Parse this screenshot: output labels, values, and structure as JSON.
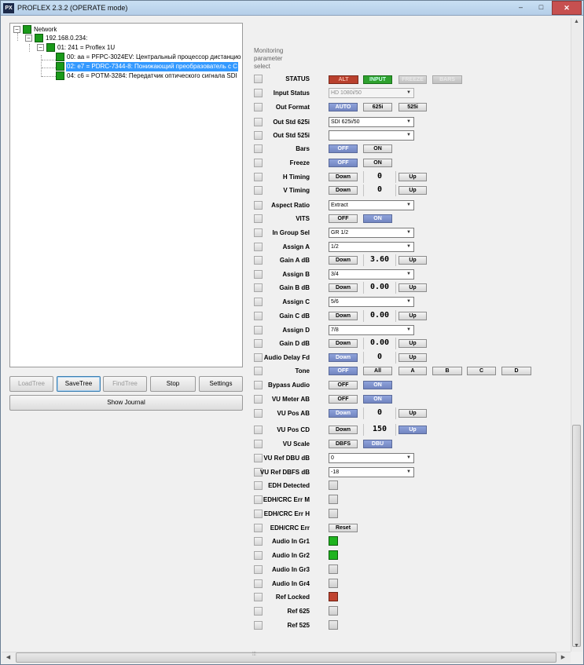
{
  "window": {
    "app_icon": "PX",
    "title": "PROFLEX 2.3.2 (OPERATE mode)",
    "minimize_glyph": "–",
    "maximize_glyph": "□",
    "close_glyph": "✕"
  },
  "tree": {
    "root": "Network",
    "ip": "192.168.0.234:",
    "chassis": "01: 241 = Proflex 1U",
    "cards": [
      "00: aa = PFPC-3024EV: Центральный процессор дистанцио",
      "02: e7 = PDRC-7344-8: Понижающий преобразователь с С",
      "04: c6 = POTM-3284: Передатчик оптического сигнала SDI"
    ],
    "expand_glyph": "−"
  },
  "buttons": {
    "load_tree": "LoadTree",
    "save_tree": "SaveTree",
    "find_tree": "FindTree",
    "stop": "Stop",
    "settings": "Settings",
    "show_journal": "Show Journal"
  },
  "monitor_header": "Monitoring parameter select",
  "params": {
    "status": {
      "label": "STATUS",
      "flags": [
        "ALT",
        "INPUT",
        "FREEZE",
        "BARS"
      ]
    },
    "input_status": {
      "label": "Input Status",
      "value": "HD 1080i/50"
    },
    "out_format": {
      "label": "Out Format",
      "options": [
        "AUTO",
        "625i",
        "525i"
      ]
    },
    "out_std_625i": {
      "label": "Out Std 625i",
      "value": "SDI 625i/50"
    },
    "out_std_525i": {
      "label": "Out Std 525i",
      "value": ""
    },
    "bars": {
      "label": "Bars",
      "off": "OFF",
      "on": "ON"
    },
    "freeze": {
      "label": "Freeze",
      "off": "OFF",
      "on": "ON"
    },
    "h_timing": {
      "label": "H Timing",
      "down": "Down",
      "value": "0",
      "up": "Up"
    },
    "v_timing": {
      "label": "V Timing",
      "down": "Down",
      "value": "0",
      "up": "Up"
    },
    "aspect_ratio": {
      "label": "Aspect Ratio",
      "value": "Extract"
    },
    "vits": {
      "label": "VITS",
      "off": "OFF",
      "on": "ON"
    },
    "in_group_sel": {
      "label": "In Group Sel",
      "value": "GR 1/2"
    },
    "assign_a": {
      "label": "Assign A",
      "value": "1/2"
    },
    "gain_a": {
      "label": "Gain A dB",
      "down": "Down",
      "value": "3.60",
      "up": "Up"
    },
    "assign_b": {
      "label": "Assign B",
      "value": "3/4"
    },
    "gain_b": {
      "label": "Gain B dB",
      "down": "Down",
      "value": "0.00",
      "up": "Up"
    },
    "assign_c": {
      "label": "Assign C",
      "value": "5/6"
    },
    "gain_c": {
      "label": "Gain C dB",
      "down": "Down",
      "value": "0.00",
      "up": "Up"
    },
    "assign_d": {
      "label": "Assign D",
      "value": "7/8"
    },
    "gain_d": {
      "label": "Gain D dB",
      "down": "Down",
      "value": "0.00",
      "up": "Up"
    },
    "audio_delay": {
      "label": "Audio Delay Fd",
      "down": "Down",
      "value": "0",
      "up": "Up"
    },
    "tone": {
      "label": "Tone",
      "options": [
        "OFF",
        "All",
        "A",
        "B",
        "C",
        "D"
      ]
    },
    "bypass_audio": {
      "label": "Bypass Audio",
      "off": "OFF",
      "on": "ON"
    },
    "vu_meter_ab": {
      "label": "VU Meter AB",
      "off": "OFF",
      "on": "ON"
    },
    "vu_pos_ab": {
      "label": "VU Pos AB",
      "down": "Down",
      "value": "0",
      "up": "Up"
    },
    "vu_pos_cd": {
      "label": "VU Pos CD",
      "down": "Down",
      "value": "150",
      "up": "Up"
    },
    "vu_scale": {
      "label": "VU Scale",
      "options": [
        "DBFS",
        "DBU"
      ]
    },
    "vu_ref_dbu": {
      "label": "VU Ref DBU dB",
      "value": "0"
    },
    "vu_ref_dbfs": {
      "label": "VU Ref DBFS dB",
      "value": "-18"
    },
    "edh_detected": {
      "label": "EDH Detected"
    },
    "edh_crc_err_m": {
      "label": "EDH/CRC Err M"
    },
    "edh_crc_err_h": {
      "label": "EDH/CRC Err H"
    },
    "edh_crc_err": {
      "label": "EDH/CRC Err",
      "reset": "Reset"
    },
    "audio_in_gr1": {
      "label": "Audio In Gr1"
    },
    "audio_in_gr2": {
      "label": "Audio In Gr2"
    },
    "audio_in_gr3": {
      "label": "Audio In Gr3"
    },
    "audio_in_gr4": {
      "label": "Audio In Gr4"
    },
    "ref_locked": {
      "label": "Ref Locked"
    },
    "ref_625": {
      "label": "Ref 625"
    },
    "ref_525": {
      "label": "Ref 525"
    }
  },
  "colors": {
    "selected_blue": "#3399ff",
    "active_toggle": "#7f93d0",
    "indicator_green": "#1fb31f",
    "indicator_red": "#c0432f",
    "status_alt": "#b9402d",
    "status_input": "#2ea12e"
  },
  "scroll": {
    "grip": "⦙⦙⦙",
    "up": "▲",
    "down": "▼",
    "left": "◀",
    "right": "▶"
  },
  "icons": {
    "dropdown": "chevron-down-icon",
    "tree_node": "green-node-icon"
  }
}
